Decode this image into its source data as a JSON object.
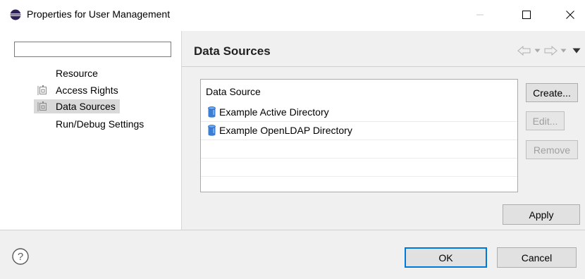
{
  "window": {
    "title": "Properties for User Management",
    "icon": "eclipse-icon",
    "controls": {
      "minimize": "minimize-icon",
      "maximize": "maximize-icon",
      "close": "close-icon"
    }
  },
  "sidebar": {
    "filter": {
      "value": "",
      "placeholder": ""
    },
    "items": [
      {
        "label": "Resource",
        "icon": "",
        "selected": false
      },
      {
        "label": "Access Rights",
        "icon": "property-page-icon",
        "selected": false
      },
      {
        "label": "Data Sources",
        "icon": "property-page-icon",
        "selected": true
      },
      {
        "label": "Run/Debug Settings",
        "icon": "",
        "selected": false
      }
    ]
  },
  "page": {
    "title": "Data Sources",
    "nav": {
      "back": "back-arrow-icon",
      "forward": "forward-arrow-icon",
      "menu": "view-menu-icon"
    }
  },
  "data_sources": {
    "column_header": "Data Source",
    "rows": [
      {
        "name": "Example Active Directory",
        "icon": "database-icon"
      },
      {
        "name": "Example OpenLDAP Directory",
        "icon": "database-icon"
      }
    ]
  },
  "side_buttons": {
    "create": "Create...",
    "edit": "Edit...",
    "remove": "Remove"
  },
  "apply_label": "Apply",
  "footer": {
    "help_icon": "help-icon",
    "ok": "OK",
    "cancel": "Cancel"
  },
  "colors": {
    "accent": "#0078d7",
    "db_icon": "#3a7fd5",
    "selection": "#d9d9d9"
  }
}
